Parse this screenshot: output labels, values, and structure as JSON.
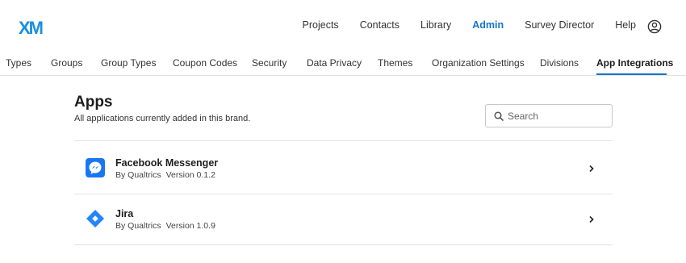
{
  "header": {
    "logo": "XM",
    "nav": [
      {
        "label": "Projects",
        "active": false
      },
      {
        "label": "Contacts",
        "active": false
      },
      {
        "label": "Library",
        "active": false
      },
      {
        "label": "Admin",
        "active": true
      },
      {
        "label": "Survey Director",
        "active": false
      },
      {
        "label": "Help",
        "active": false
      }
    ],
    "profile_icon": "user-circle-icon"
  },
  "subnav": {
    "tabs": [
      {
        "label": "Types",
        "active": false
      },
      {
        "label": "Groups",
        "active": false
      },
      {
        "label": "Group Types",
        "active": false
      },
      {
        "label": "Coupon Codes",
        "active": false
      },
      {
        "label": "Security",
        "active": false
      },
      {
        "label": "Data Privacy",
        "active": false
      },
      {
        "label": "Themes",
        "active": false
      },
      {
        "label": "Organization Settings",
        "active": false
      },
      {
        "label": "Divisions",
        "active": false
      },
      {
        "label": "App Integrations",
        "active": true
      }
    ]
  },
  "main": {
    "title": "Apps",
    "subtitle": "All applications currently added in this brand.",
    "search": {
      "placeholder": "Search",
      "value": ""
    },
    "apps": [
      {
        "name": "Facebook Messenger",
        "publisher": "By Qualtrics",
        "version": "Version 0.1.2",
        "icon": "messenger-icon"
      },
      {
        "name": "Jira",
        "publisher": "By Qualtrics",
        "version": "Version 1.0.9",
        "icon": "jira-icon"
      }
    ]
  },
  "colors": {
    "accent": "#1774c6",
    "logo": "#1a8fe0",
    "messenger": "#1877f2",
    "jira": "#2684ff"
  }
}
